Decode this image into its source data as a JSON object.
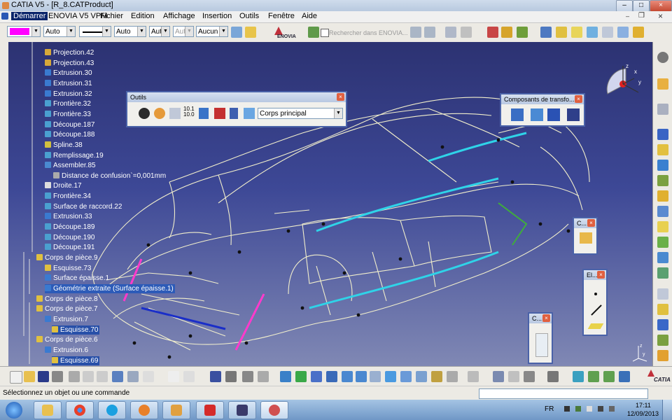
{
  "window": {
    "title": "CATIA V5 - [R_8.CATProduct]",
    "controls": [
      "–",
      "□",
      "×"
    ]
  },
  "menu": [
    "Démarrer",
    "ENOVIA V5 VPM",
    "Fichier",
    "Edition",
    "Affichage",
    "Insertion",
    "Outils",
    "Fenêtre",
    "Aide"
  ],
  "toolbar": {
    "fill_color": "#ff00ff",
    "combo_auto1": "Auto",
    "combo_auto2": "Auto",
    "combo_aut3": "Aut",
    "combo_aut4": "Aut",
    "combo_none": "Aucun",
    "enovia_label": "ENOVIA",
    "search_placeholder": "Rechercher dans ENOVIA..."
  },
  "tree": [
    {
      "label": "Projection.42"
    },
    {
      "label": "Projection.43"
    },
    {
      "label": "Extrusion.30"
    },
    {
      "label": "Extrusion.31"
    },
    {
      "label": "Extrusion.32"
    },
    {
      "label": "Frontière.32"
    },
    {
      "label": "Frontière.33"
    },
    {
      "label": "Découpe.187"
    },
    {
      "label": "Découpe.188"
    },
    {
      "label": "Spline.38"
    },
    {
      "label": "Remplissage.19"
    },
    {
      "label": "Assembler.85"
    },
    {
      "label": "Distance de confusion`=0,001mm"
    },
    {
      "label": "Droite.17"
    },
    {
      "label": "Frontière.34"
    },
    {
      "label": "Surface de raccord.22"
    },
    {
      "label": "Extrusion.33"
    },
    {
      "label": "Découpe.189"
    },
    {
      "label": "Découpe.190"
    },
    {
      "label": "Découpe.191"
    },
    {
      "label": "Corps de pièce.9"
    },
    {
      "label": "Esquisse.73"
    },
    {
      "label": "Surface épaisse.1"
    },
    {
      "label": "Géométrie extraite (Surface épaisse.1)"
    },
    {
      "label": "Corps de pièce.8"
    },
    {
      "label": "Corps de pièce.7"
    },
    {
      "label": "Extrusion.7"
    },
    {
      "label": "Esquisse.70"
    },
    {
      "label": "Corps de pièce.6"
    },
    {
      "label": "Extrusion.6"
    },
    {
      "label": "Esquisse.69"
    }
  ],
  "palettes": {
    "outils": {
      "title": "Outils",
      "body_select": "Corps principal",
      "icon_text": "10.1\n10.0"
    },
    "composants": {
      "title": "Composants de transfo..."
    },
    "c1": {
      "title": "C..."
    },
    "el": {
      "title": "El..."
    },
    "c2": {
      "title": "C..."
    }
  },
  "status": {
    "message": "Sélectionnez un objet ou une commande"
  },
  "taskbar": {
    "lang": "FR",
    "time": "17:11",
    "date": "12/09/2013"
  },
  "compass": {
    "axes": [
      "x",
      "y",
      "z"
    ]
  },
  "axis_labels": {
    "y": "y",
    "z": "z"
  },
  "catia_logo": "CATIA"
}
